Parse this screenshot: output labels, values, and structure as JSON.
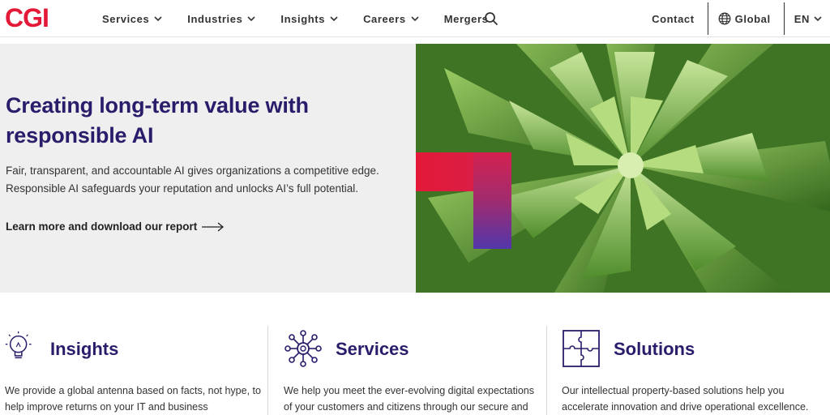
{
  "header": {
    "logo": "CGI",
    "nav": [
      {
        "label": "Services",
        "has_dropdown": true
      },
      {
        "label": "Industries",
        "has_dropdown": true
      },
      {
        "label": "Insights",
        "has_dropdown": true
      },
      {
        "label": "Careers",
        "has_dropdown": true
      },
      {
        "label": "Mergers",
        "has_dropdown": false
      }
    ],
    "search_icon": "search-icon",
    "contact": "Contact",
    "global": "Global",
    "language": "EN"
  },
  "hero": {
    "title": "Creating long-term value with responsible AI",
    "description_line1": "Fair, transparent, and accountable AI gives organizations a competitive edge.",
    "description_line2": "Responsible AI safeguards your reputation and unlocks AI’s full potential.",
    "link": "Learn more and download our report"
  },
  "cards": [
    {
      "icon": "lightbulb-icon",
      "title": "Insights",
      "text_line1": "We provide a global antenna based on facts, not hype, to",
      "text_line2": "help improve returns on your IT and business"
    },
    {
      "icon": "network-hub-icon",
      "title": "Services",
      "text_line1": "We help you meet the ever-evolving digital expectations",
      "text_line2": "of your customers and citizens through our secure and"
    },
    {
      "icon": "puzzle-icon",
      "title": "Solutions",
      "text_line1": "Our intellectual property-based solutions help you",
      "text_line2": "accelerate innovation and drive operational excellence."
    }
  ],
  "colors": {
    "brand_red": "#e31937",
    "heading_purple": "#2b1c6b",
    "hero_bg": "#efefef",
    "accent_purple": "#5236ab"
  }
}
